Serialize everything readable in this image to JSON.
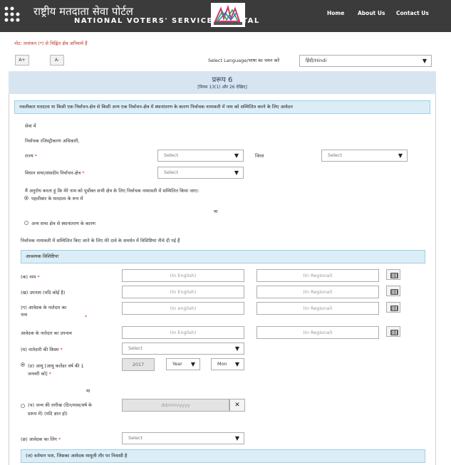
{
  "header": {
    "title_hindi": "राष्ट्रीय मतदाता सेवा पोर्टल",
    "title_english": "NATIONAL VOTERS' SERVICES PORTAL",
    "nav": [
      "Home",
      "About Us",
      "Contact Us"
    ]
  },
  "notice": "नोट: तारांकन (*) से चिह्नित क्षेत्र अनिवार्य हैं",
  "font_controls": {
    "increase": "A+",
    "decrease": "A-"
  },
  "language": {
    "label": "Select Language/भाषा का चयन करें",
    "selected": "हिंदी/Hindi"
  },
  "form": {
    "title": "प्ररूप 6",
    "subtitle": "[नियम 13(1) और 26 देखिए]",
    "purpose": "नवलीकार मतदाता या किसी एक निर्वाचन-क्षेत्र से किसी अन्य एक निर्वाचन-क्षेत्र में स्थानांतरण के कारण निर्वाचक नामावली में नाम को सम्मिलित करने के लिए आवेदन",
    "to_label": "सेवा में",
    "officer_label": "निर्वाचक रजिस्ट्रीकरण अधिकारी,",
    "state_label": "राज्य",
    "district_label": "जिला",
    "constituency_label": "विधान सभा/संसदीय निर्वाचन-क्षेत्र",
    "select_placeholder": "Select",
    "request_text": "मैं अनुरोध करता हूं कि मेरे नाम को पूर्वोक्त सभी क्षेत्र के लिए निर्वाचक नामावली में सम्मिलित किया जाए।",
    "option_new": "पहलीबार के मतदाता के रूप में",
    "or_text": "या",
    "option_shift": "अन्य सभा क्षेत्र से स्थानांतरण के कारण",
    "details_text": "निर्वाचक नामावली में सम्मिलित किए जाने के लिए मेरे दावे के समर्थन में विशिष्टियां नीचे दी गई हैं",
    "section_title": "आवश्यक विशिष्टियां",
    "fields": {
      "name": "(क) नाम",
      "surname": "(ख) उपनाम (यदि कोई है)",
      "relative_name_1": "(ग) आवेदक के नातेदार का",
      "relative_name_2": "नाम",
      "relative_surname": "आवेदक के नातेदार का उपनाम",
      "relation_type": "(घ) नातेदारी की किस्म",
      "age_1": "(ङ) आयु [आयु कलेंडर वर्ष की 1",
      "age_2": "जनवरी को]",
      "dob_1": "(च) जन्म की तारीख (दिन/मास/वर्ष के",
      "dob_2": "प्ररूप में) (यदि ज्ञात हो)",
      "gender": "(छ) आवेदक का लिंग",
      "address_bar": "(ज) वर्तमान पता, जिसका आवेदक मामूली तौर पर निवासी है"
    },
    "placeholders": {
      "english": "(In English)",
      "english_lower": "(In english)",
      "regional": "(In Regional)",
      "date": "dd/mm/yyyy"
    },
    "age_year_value": "2017",
    "year_select": "Year",
    "month_select": "Mon"
  }
}
